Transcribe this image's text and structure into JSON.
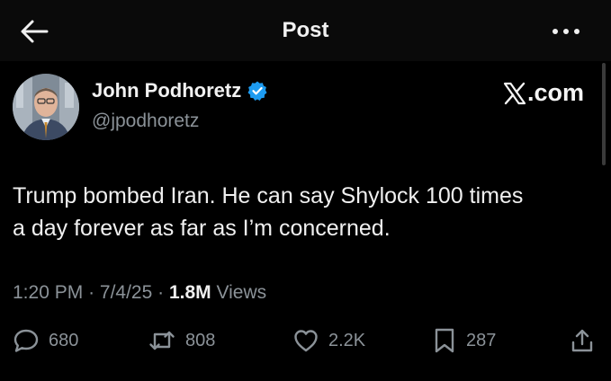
{
  "header": {
    "title": "Post"
  },
  "author": {
    "display_name": "John Podhoretz",
    "handle": "@jpodhoretz",
    "verified_color": "#1d9bf0"
  },
  "branding": {
    "site_label": ".com"
  },
  "tweet": {
    "text_line1": "Trump bombed Iran. He can say Shylock 100 times",
    "text_line2": "a day forever as far as I’m concerned.",
    "time": "1:20 PM",
    "date": "7/4/25",
    "views_count": "1.8M",
    "views_label": "Views",
    "separator": "·"
  },
  "actions": {
    "replies": "680",
    "reposts": "808",
    "likes": "2.2K",
    "bookmarks": "287"
  },
  "icons": {
    "back": "arrow-left-icon",
    "more": "more-horizontal-icon",
    "verified": "verified-badge-icon",
    "x_logo": "x-logo-icon",
    "reply": "reply-icon",
    "repost": "repost-icon",
    "like": "heart-icon",
    "bookmark": "bookmark-icon",
    "share": "share-icon"
  }
}
